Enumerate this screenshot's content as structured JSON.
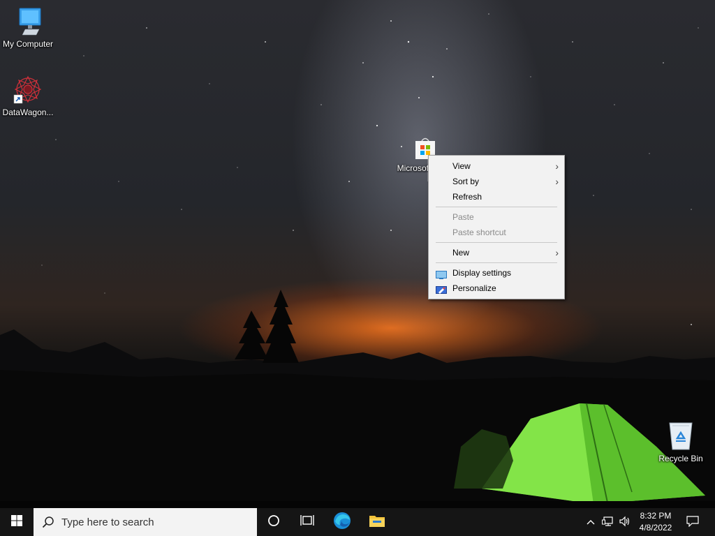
{
  "desktop": {
    "icons": [
      {
        "label": "My Computer",
        "icon": "monitor-icon"
      },
      {
        "label": "DataWagon...",
        "icon": "datawagon-shortcut-icon"
      },
      {
        "label": "Microsoft Store",
        "icon": "microsoft-store-icon"
      },
      {
        "label": "Recycle Bin",
        "icon": "recycle-bin-icon"
      }
    ]
  },
  "context_menu": {
    "view": "View",
    "sort_by": "Sort by",
    "refresh": "Refresh",
    "paste": "Paste",
    "paste_shortcut": "Paste shortcut",
    "new": "New",
    "display_settings": "Display settings",
    "personalize": "Personalize",
    "submenu_arrow": "›"
  },
  "taskbar": {
    "search_placeholder": "Type here to search",
    "pinned": [
      "cortana-icon",
      "task-view-icon",
      "edge-icon",
      "file-explorer-icon"
    ],
    "time": "8:32 PM",
    "date": "4/8/2022"
  },
  "colors": {
    "taskbar": "#151515",
    "menu_bg": "#f2f2f2",
    "tent_green": "#7ee03a"
  }
}
